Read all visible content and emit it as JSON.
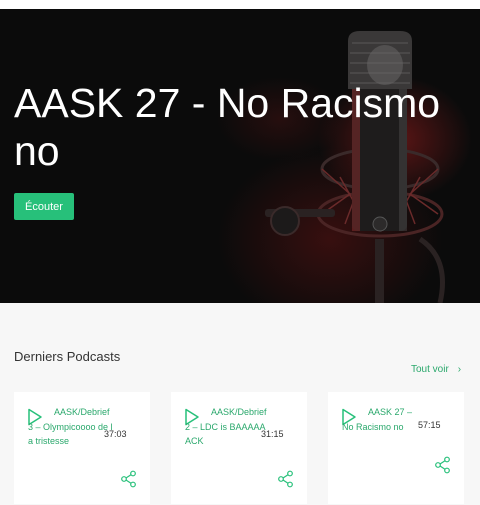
{
  "hero": {
    "title": "AASK 27 - No Racismo no",
    "listen_label": "Écouter"
  },
  "latest": {
    "heading": "Derniers Podcasts",
    "see_all_label": "Tout voir",
    "see_all_icon": "chevron-right-icon"
  },
  "podcasts": [
    {
      "title": "AASK/Debrief 3 – Olympicoooo de la tristesse",
      "duration": "37:03",
      "play_icon": "play-icon",
      "share_icon": "share-icon"
    },
    {
      "title": "AASK/Debrief 2 – LDC is BAAAAAACK",
      "duration": "31:15",
      "play_icon": "play-icon",
      "share_icon": "share-icon"
    },
    {
      "title": "AASK 27 – No Racismo no",
      "duration": "57:15",
      "play_icon": "play-icon",
      "share_icon": "share-icon"
    }
  ],
  "colors": {
    "accent": "#27c07a",
    "hero_bg": "#0b0b0b",
    "page_bg": "#f7f7f7"
  }
}
